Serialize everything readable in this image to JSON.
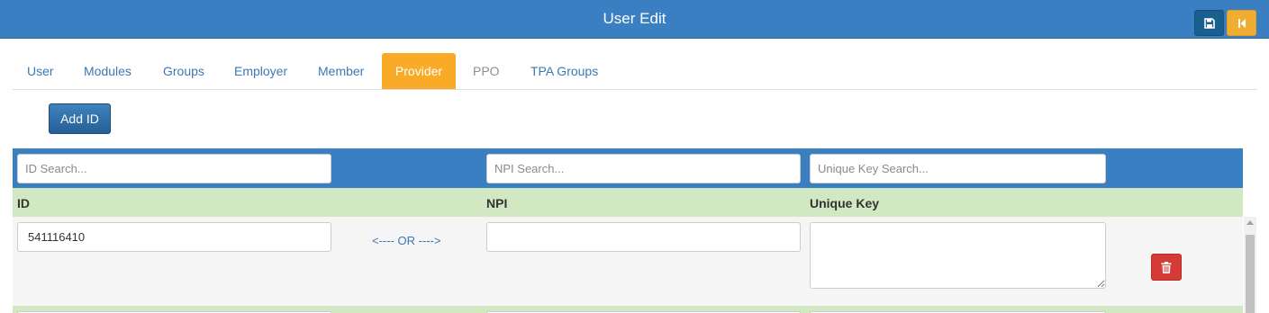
{
  "header": {
    "title": "User Edit",
    "save_icon": "save-icon",
    "back_icon": "skip-back-icon"
  },
  "tabs": [
    {
      "label": "User",
      "state": "normal"
    },
    {
      "label": "Modules",
      "state": "normal"
    },
    {
      "label": "Groups",
      "state": "normal"
    },
    {
      "label": "Employer",
      "state": "normal"
    },
    {
      "label": "Member",
      "state": "normal"
    },
    {
      "label": "Provider",
      "state": "active"
    },
    {
      "label": "PPO",
      "state": "disabled"
    },
    {
      "label": "TPA Groups",
      "state": "normal"
    }
  ],
  "toolbar": {
    "add_label": "Add ID"
  },
  "search": {
    "id_placeholder": "ID Search...",
    "npi_placeholder": "NPI Search...",
    "key_placeholder": "Unique Key Search..."
  },
  "columns": {
    "id": "ID",
    "npi": "NPI",
    "key": "Unique Key"
  },
  "rows": [
    {
      "id": "541116410",
      "or_label": "<---- OR ---->",
      "npi": "",
      "key": "",
      "delete_icon": "trash-icon"
    }
  ],
  "colors": {
    "primary": "#3a7fc1",
    "active_tab": "#f9ab27",
    "header_row": "#d2e8c3",
    "danger": "#d43b37"
  }
}
